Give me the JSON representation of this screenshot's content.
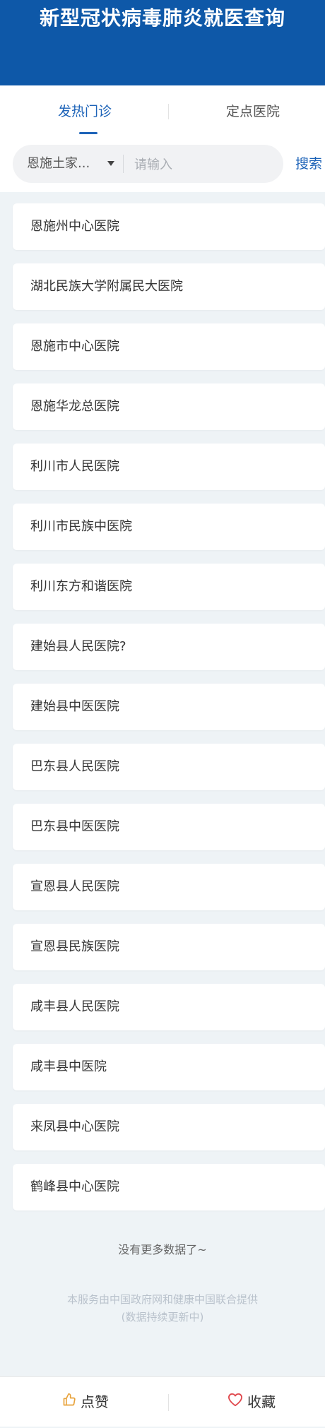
{
  "header": {
    "title": "新型冠状病毒肺炎就医查询"
  },
  "tabs": [
    {
      "label": "发热门诊",
      "active": true
    },
    {
      "label": "定点医院",
      "active": false
    }
  ],
  "search": {
    "region": "恩施土家...",
    "placeholder": "请输入",
    "button_label": "搜索"
  },
  "hospitals": [
    "恩施州中心医院",
    "湖北民族大学附属民大医院",
    "恩施市中心医院",
    "恩施华龙总医院",
    "利川市人民医院",
    "利川市民族中医院",
    "利川东方和谐医院",
    "建始县人民医院?",
    "建始县中医医院",
    "巴东县人民医院",
    "巴东县中医医院",
    "宣恩县人民医院",
    "宣恩县民族医院",
    "咸丰县人民医院",
    "咸丰县中医院",
    "来凤县中心医院",
    "鹤峰县中心医院"
  ],
  "list_end_text": "没有更多数据了~",
  "footnote": {
    "line1": "本服务由中国政府网和健康中国联合提供",
    "line2": "(数据持续更新中)"
  },
  "bottom_bar": {
    "like_label": "点赞",
    "favorite_label": "收藏"
  },
  "colors": {
    "header_bg": "#0e58a8",
    "accent": "#1d63b8",
    "page_bg": "#eef3f6",
    "favorite_icon": "#e0474c",
    "like_icon": "#e8a23a"
  },
  "icons": {
    "caret": "chevron-down-icon",
    "like": "thumbs-up-icon",
    "favorite": "heart-icon"
  }
}
